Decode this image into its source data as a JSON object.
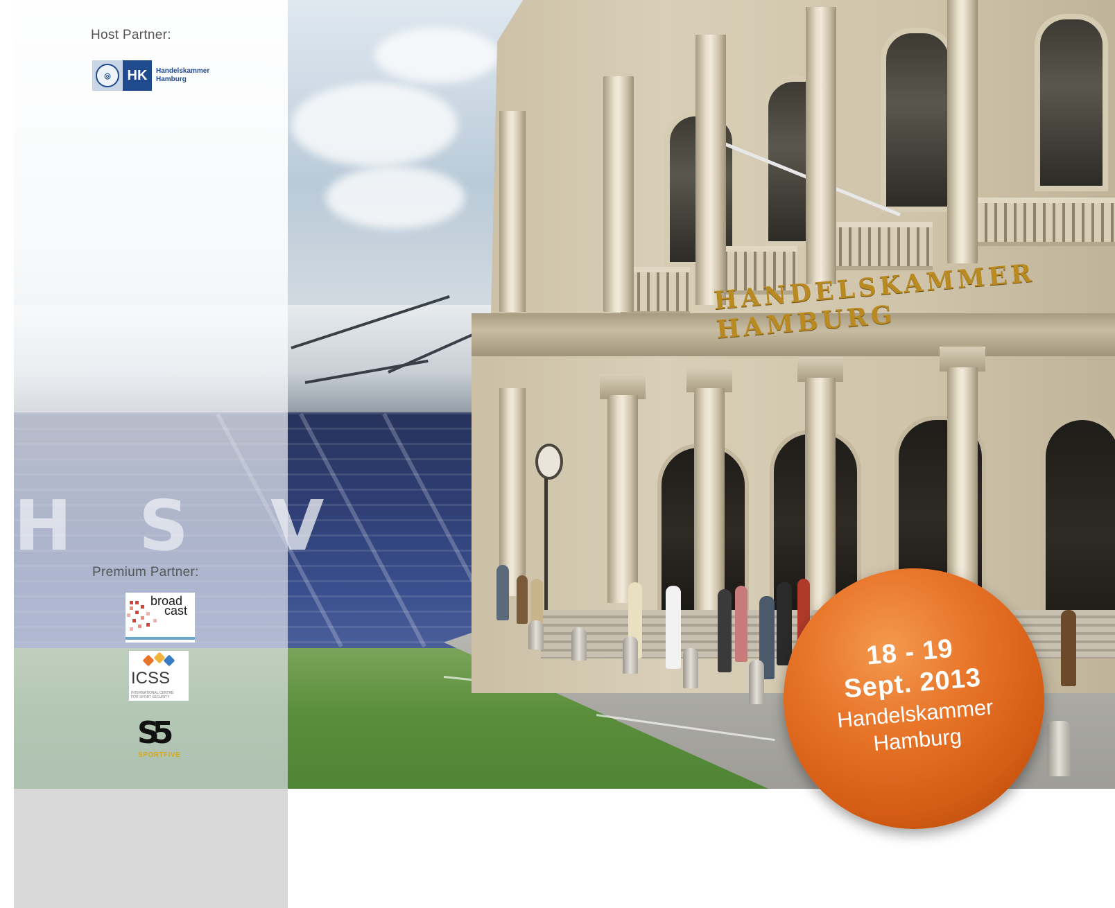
{
  "sidebar": {
    "host_label": "Host Partner:",
    "host_logo": {
      "abbr": "HK",
      "name_line1": "Handelskammer",
      "name_line2": "Hamburg",
      "color": "#1f4a8e"
    },
    "premium_label": "Premium Partner:",
    "premium_logos": {
      "broadcast": {
        "line1": "broad",
        "line2": "cast"
      },
      "icss": {
        "text": "ICSS",
        "sub1": "INTERNATIONAL CENTRE",
        "sub2": "FOR SPORT SECURITY"
      },
      "sportfive": {
        "glyph": "S5",
        "text": "SPORTFIVE"
      }
    }
  },
  "photo": {
    "building_sign": "HANDELSKAMMER HAMBURG"
  },
  "badge": {
    "dates": "18 - 19",
    "month_year": "Sept. 2013",
    "venue_line1": "Handelskammer",
    "venue_line2": "Hamburg",
    "color": "#e8752a"
  }
}
